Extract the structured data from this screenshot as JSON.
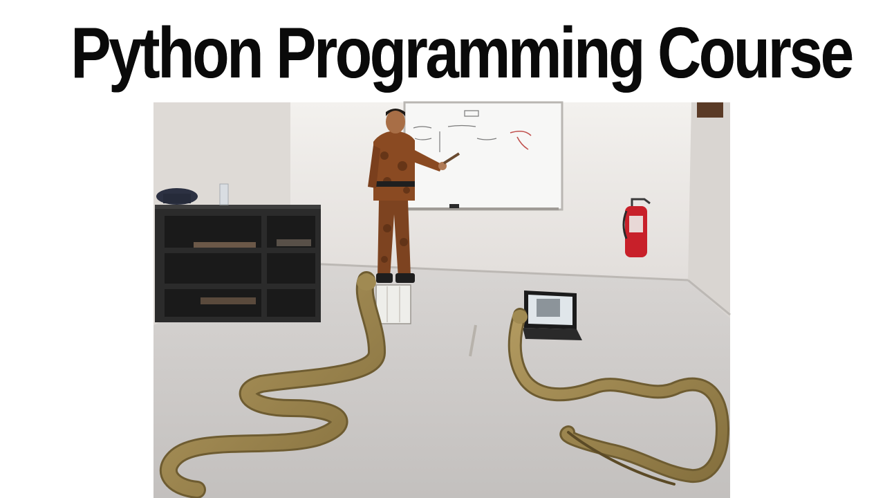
{
  "title": "Python Programming Course",
  "colors": {
    "title_text": "#0a0a0a",
    "title_outline": "#ffffff",
    "background": "#ffffff",
    "floor": "#c9c6c4",
    "wall": "#e9e6e3",
    "uniform": "#8a4a22",
    "snake": "#9c8550",
    "extinguisher": "#c8202a"
  },
  "scene": {
    "whiteboard_icon": "whiteboard-icon",
    "laptop_icon": "laptop-icon",
    "fire_extinguisher_icon": "fire-extinguisher-icon",
    "shelf_icon": "bookshelf-icon",
    "snake_icon": "snake-icon",
    "instructor_icon": "instructor-icon"
  }
}
